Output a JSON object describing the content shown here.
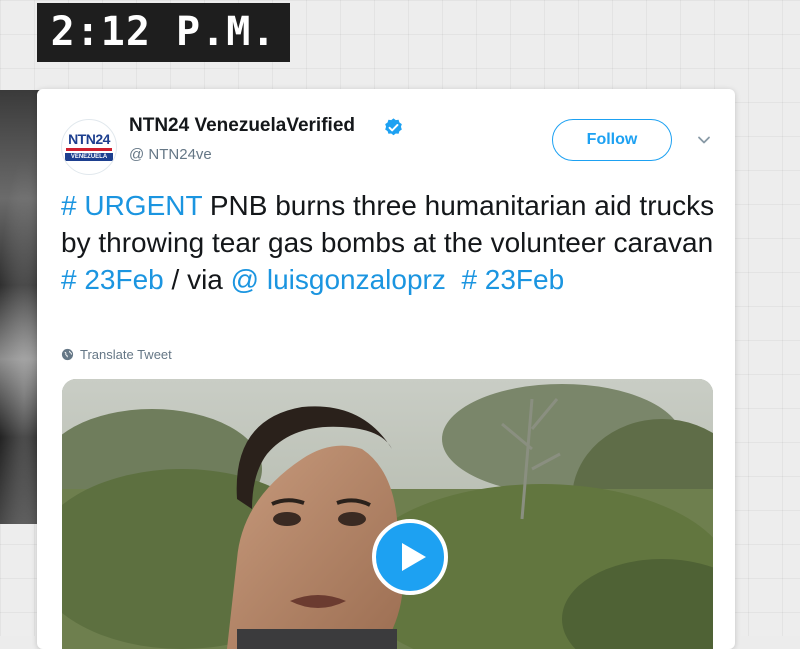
{
  "timestamp": "2:12 P.M.",
  "tweet": {
    "author_name": "NTN24 VenezuelaVerified",
    "handle": "@ NTN24ve",
    "avatar": {
      "line1": "NTN24",
      "line2": "VENEZUELA"
    },
    "follow_label": "Follow",
    "text_parts": {
      "p1": "# URGENT",
      "p2": " PNB burns three humanitarian aid trucks by throwing tear gas bombs at the volunteer caravan ",
      "p3": "# 23Feb",
      "p4": " / via ",
      "p5": "@ luisgonzaloprz",
      "p6": "  ",
      "p7": "# 23Feb"
    },
    "translate_label": "Translate Tweet",
    "media": {
      "type": "video",
      "play_icon": "play-icon"
    }
  },
  "colors": {
    "link": "#1b95e0",
    "follow_border": "#1da1f2",
    "verified": "#1da1f2",
    "badge_bg": "#1e1e1e"
  }
}
